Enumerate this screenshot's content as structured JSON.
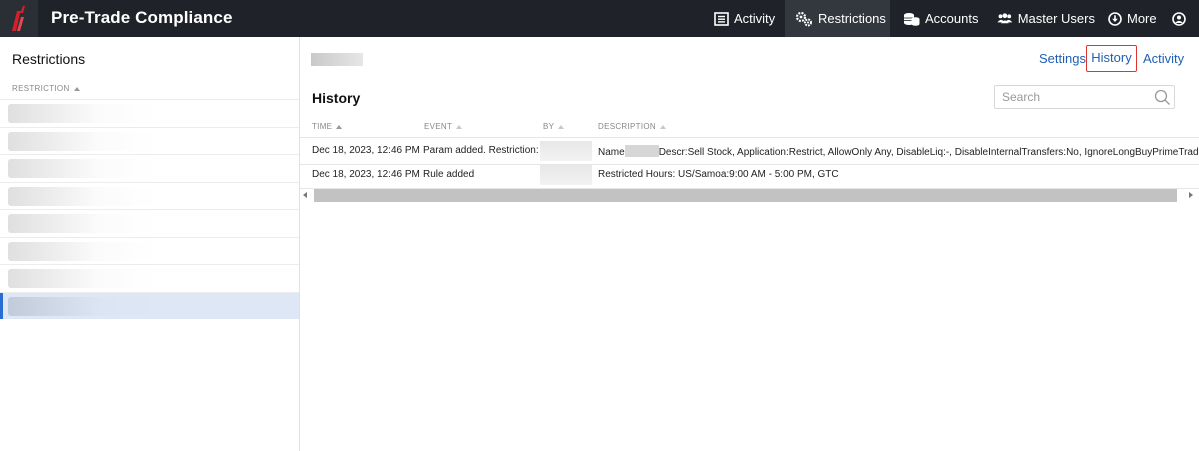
{
  "app": {
    "title": "Pre-Trade Compliance"
  },
  "nav": {
    "activity": "Activity",
    "restrictions": "Restrictions",
    "accounts": "Accounts",
    "master_users": "Master Users",
    "more": "More",
    "icons": {
      "activity": "document-list-icon",
      "restrictions": "gears-icon",
      "accounts": "coins-icon",
      "master_users": "users-icon",
      "more": "download-circle-icon",
      "user": "user-circle-icon"
    }
  },
  "left_panel": {
    "title": "Restrictions",
    "column_header": "RESTRICTION",
    "selected_index": 7
  },
  "detail": {
    "links": {
      "settings": "Settings",
      "history": "History",
      "activity": "Activity"
    },
    "heading": "History",
    "search": {
      "placeholder": "Search",
      "value": ""
    },
    "columns": {
      "time": "TIME",
      "event": "EVENT",
      "by": "BY",
      "description": "DESCRIPTION"
    },
    "rows": [
      {
        "time": "Dec 18, 2023, 12:46 PM",
        "event": "Param added. Restriction:",
        "by": "",
        "desc_prefix": "Name",
        "desc_rest": "Descr:Sell Stock, Application:Restrict, AllowOnly Any, DisableLiq:-, DisableInternalTransfers:No, IgnoreLongBuyPrimeTrades:No"
      },
      {
        "time": "Dec 18, 2023, 12:46 PM",
        "event": "Rule added",
        "by": "",
        "desc_prefix": "",
        "desc_rest": "Restricted Hours: US/Samoa:9:00 AM - 5:00 PM, GTC"
      }
    ]
  },
  "colors": {
    "nav_bg": "#1f2329",
    "active_nav_bg": "#33373e",
    "link": "#1f5fb3",
    "highlight_border": "#dd3333",
    "selected_row": "#dde7f5",
    "brand_red": "#d4202c"
  }
}
